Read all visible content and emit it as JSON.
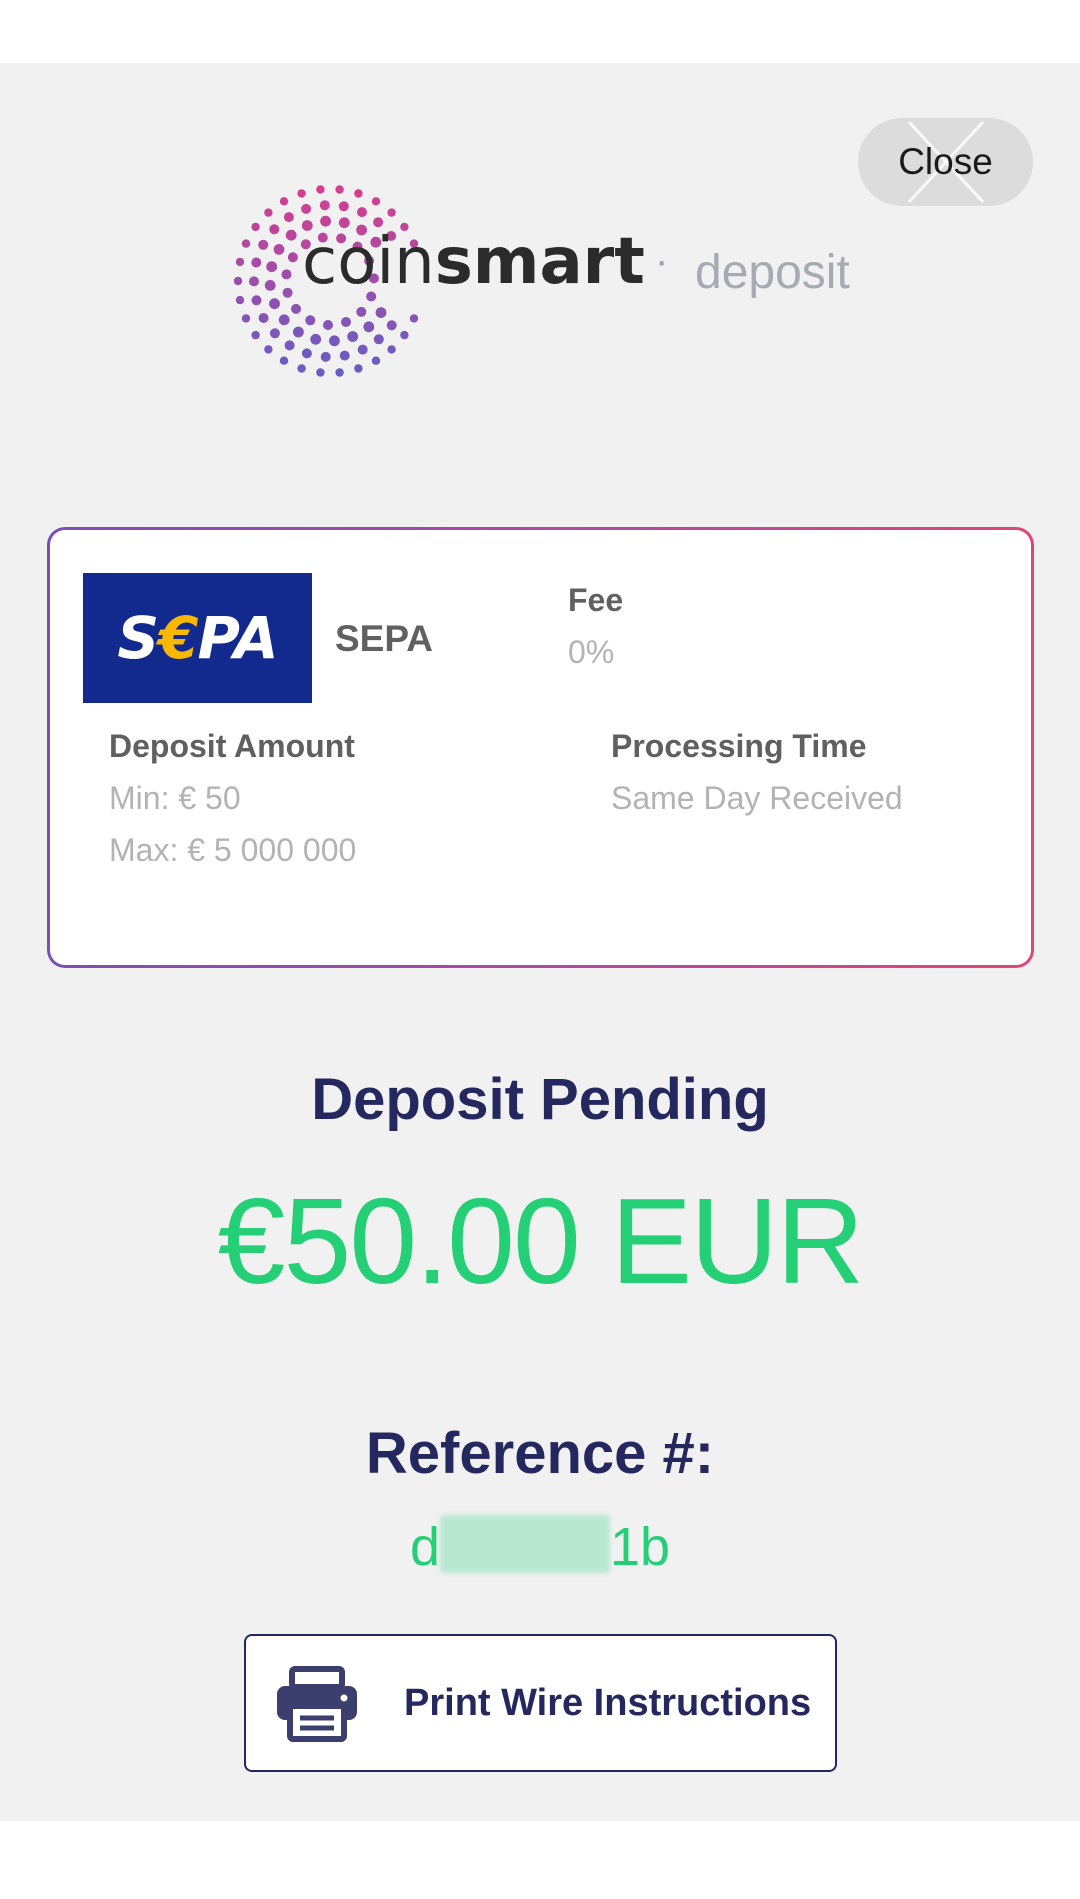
{
  "header": {
    "close_label": "Close",
    "brand_light": "coin",
    "brand_bold": "smart",
    "separator": "·",
    "subtitle": "deposit"
  },
  "method_card": {
    "logo_text_left": "S",
    "logo_text_euro": "€",
    "logo_text_right": "PA",
    "method_name": "SEPA",
    "fee_label": "Fee",
    "fee_value": "0%",
    "deposit_amount_label": "Deposit Amount",
    "min_value": "Min: € 50",
    "max_value": "Max: € 5 000 000",
    "processing_label": "Processing Time",
    "processing_value": "Same Day Received"
  },
  "status": {
    "title": "Deposit Pending",
    "amount": "€50.00 EUR"
  },
  "reference": {
    "title": "Reference #:",
    "prefix": "d",
    "suffix": "1b"
  },
  "actions": {
    "print_label": "Print Wire Instructions"
  },
  "colors": {
    "accent_green": "#25cf76",
    "navy": "#24285f",
    "sepa_blue": "#12298d",
    "sepa_gold": "#f8b700"
  }
}
